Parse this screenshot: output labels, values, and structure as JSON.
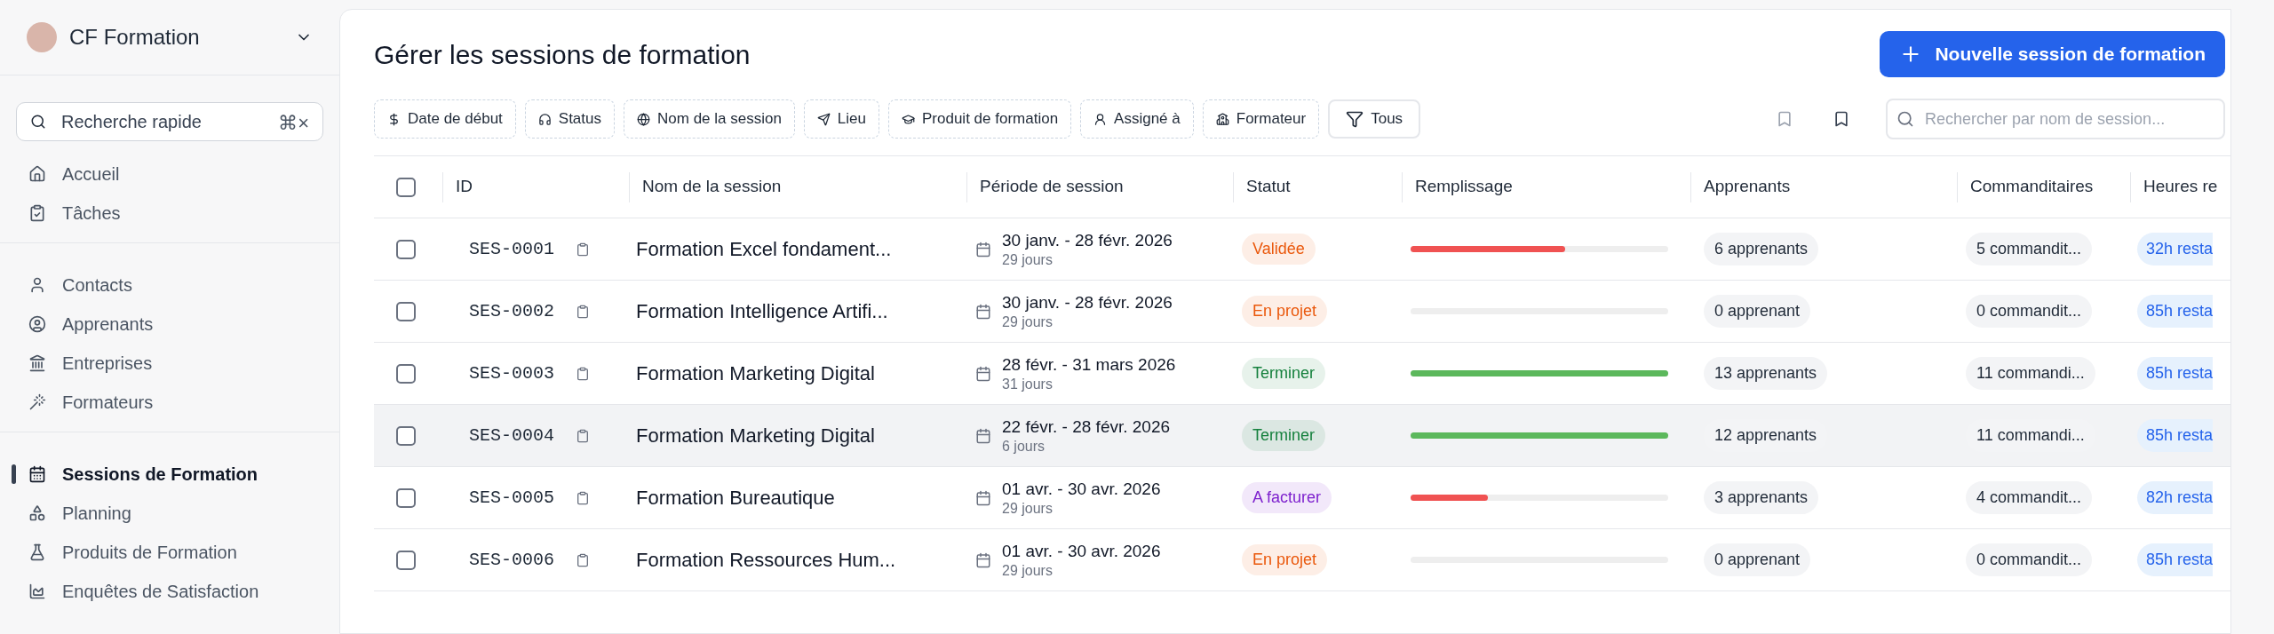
{
  "workspace": {
    "name": "CF Formation"
  },
  "quick_search": {
    "placeholder": "Recherche rapide",
    "shortcut": "⌘×"
  },
  "sidebar": {
    "groups": [
      {
        "items": [
          {
            "label": "Accueil",
            "selected": false
          },
          {
            "label": "Tâches",
            "selected": false
          }
        ]
      },
      {
        "items": [
          {
            "label": "Contacts",
            "selected": false
          },
          {
            "label": "Apprenants",
            "selected": false
          },
          {
            "label": "Entreprises",
            "selected": false
          },
          {
            "label": "Formateurs",
            "selected": false
          }
        ]
      },
      {
        "items": [
          {
            "label": "Sessions de Formation",
            "selected": true
          },
          {
            "label": "Planning",
            "selected": false
          },
          {
            "label": "Produits de Formation",
            "selected": false
          },
          {
            "label": "Enquêtes de Satisfaction",
            "selected": false
          }
        ]
      }
    ]
  },
  "page": {
    "title": "Gérer les sessions de formation",
    "new_button": "Nouvelle session de formation"
  },
  "filters": [
    {
      "label": "Date de début",
      "kind": "filter"
    },
    {
      "label": "Status",
      "kind": "filter"
    },
    {
      "label": "Nom de la session",
      "kind": "filter"
    },
    {
      "label": "Lieu",
      "kind": "filter"
    },
    {
      "label": "Produit de formation",
      "kind": "filter"
    },
    {
      "label": "Assigné à",
      "kind": "filter"
    },
    {
      "label": "Formateur",
      "kind": "filter"
    },
    {
      "label": "Tous",
      "kind": "preset"
    }
  ],
  "search": {
    "placeholder": "Rechercher par nom de session..."
  },
  "table": {
    "select_all": {
      "checked": false
    },
    "columns": [
      "ID",
      "Nom de la session",
      "Période de session",
      "Statut",
      "Remplissage",
      "Apprenants",
      "Commanditaires",
      "Heures re"
    ],
    "rows": [
      {
        "checked": false,
        "highlighted": false,
        "id": "SES-0001",
        "name": "Formation Excel fondament...",
        "period": "30 janv. - 28 févr. 2026",
        "duration": "29 jours",
        "status": {
          "label": "Validée",
          "color": "#ea580c"
        },
        "level": 0.6,
        "learners": "6 apprenants",
        "sponsors": "5 commandit...",
        "hours": "32h resta"
      },
      {
        "checked": false,
        "highlighted": false,
        "id": "SES-0002",
        "name": "Formation Intelligence Artifi...",
        "period": "30 janv. - 28 févr. 2026",
        "duration": "29 jours",
        "status": {
          "label": "En projet",
          "color": "#ea580c"
        },
        "level": 0,
        "learners": "0 apprenant",
        "sponsors": "0 commandit...",
        "hours": "85h resta"
      },
      {
        "checked": false,
        "highlighted": false,
        "id": "SES-0003",
        "name": "Formation Marketing Digital",
        "period": "28 févr. - 31 mars 2026",
        "duration": "31 jours",
        "status": {
          "label": "Terminer",
          "color": "#15803d"
        },
        "level": 1,
        "learners": "13 apprenants",
        "sponsors": "11 commandi...",
        "hours": "85h resta"
      },
      {
        "checked": false,
        "highlighted": true,
        "id": "SES-0004",
        "name": "Formation Marketing Digital",
        "period": "22 févr. - 28 févr. 2026",
        "duration": "6 jours",
        "status": {
          "label": "Terminer",
          "color": "#15803d"
        },
        "level": 1,
        "learners": "12 apprenants",
        "sponsors": "11 commandi...",
        "hours": "85h resta"
      },
      {
        "checked": false,
        "highlighted": false,
        "id": "SES-0005",
        "name": "Formation Bureautique",
        "period": "01 avr. - 30 avr. 2026",
        "duration": "29 jours",
        "status": {
          "label": "A facturer",
          "color": "#7e22ce"
        },
        "level": 0.3,
        "learners": "3 apprenants",
        "sponsors": "4 commandit...",
        "hours": "82h resta"
      },
      {
        "checked": false,
        "highlighted": false,
        "id": "SES-0006",
        "name": "Formation Ressources Hum...",
        "period": "01 avr. - 30 avr. 2026",
        "duration": "29 jours",
        "status": {
          "label": "En projet",
          "color": "#ea580c"
        },
        "level": 0,
        "learners": "0 apprenant",
        "sponsors": "0 commandit...",
        "hours": "85h resta"
      }
    ]
  }
}
